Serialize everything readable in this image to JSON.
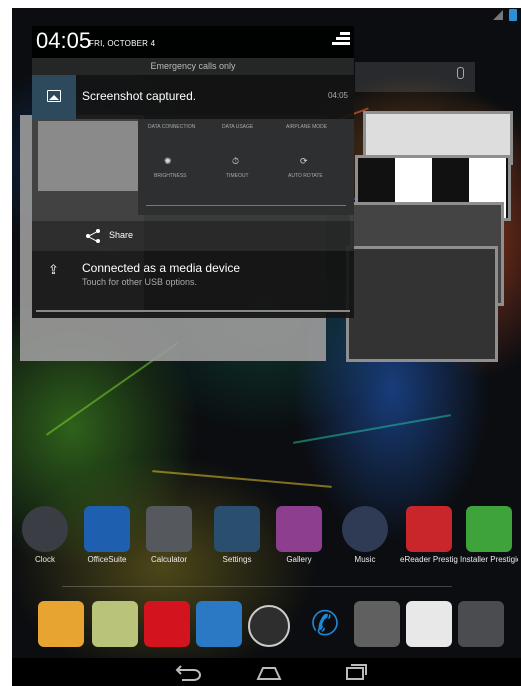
{
  "status": {
    "clock_time": "04:05",
    "clock_date": "FRI, OCTOBER 4"
  },
  "panel": {
    "emergency": "Emergency calls only",
    "notification_screenshot": {
      "title": "Screenshot captured.",
      "time": "04:05",
      "icon": "image-icon"
    },
    "preview_quick_settings": {
      "data_connection": "DATA CONNECTION",
      "data_usage": "DATA USAGE",
      "airplane_mode": "AIRPLANE MODE",
      "brightness": "BRIGHTNESS",
      "timeout": "TIMEOUT",
      "auto_rotate": "AUTO ROTATE"
    },
    "share_label": "Share",
    "notification_usb": {
      "title": "Connected as a media device",
      "subtitle": "Touch for other USB options.",
      "icon": "usb-icon"
    }
  },
  "apps": [
    {
      "label": "Clock",
      "icon": "clock-icon",
      "color": "#3a3d44"
    },
    {
      "label": "OfficeSuite",
      "icon": "officesuite-icon",
      "color": "#1f5fb0"
    },
    {
      "label": "Calculator",
      "icon": "calculator-icon",
      "color": "#55595e"
    },
    {
      "label": "Settings",
      "icon": "settings-icon",
      "color": "#2a4e6e"
    },
    {
      "label": "Gallery",
      "icon": "gallery-icon",
      "color": "#8e3e8e"
    },
    {
      "label": "Music",
      "icon": "music-icon",
      "color": "#2f3a55"
    },
    {
      "label": "eReader Prestigio",
      "icon": "ereader-icon",
      "color": "#c8262a"
    },
    {
      "label": "Installer Prestigio",
      "icon": "installer-icon",
      "color": "#3da33a"
    }
  ],
  "hotseat": [
    {
      "icon": "email-icon",
      "color": "#e7a431"
    },
    {
      "icon": "launcher-icon",
      "color": "#b9c47a"
    },
    {
      "icon": "opera-icon",
      "color": "#d3141f"
    },
    {
      "icon": "es-file-explorer-icon",
      "color": "#2b78c4"
    },
    {
      "icon": "all-apps-icon",
      "color": "#2e2e2e"
    },
    {
      "icon": "phone-icon",
      "color": "#1c88d6"
    },
    {
      "icon": "video-icon",
      "color": "#606060"
    },
    {
      "icon": "play-store-icon",
      "color": "#e8e8e8"
    },
    {
      "icon": "camera-icon",
      "color": "#4a4c50"
    }
  ]
}
